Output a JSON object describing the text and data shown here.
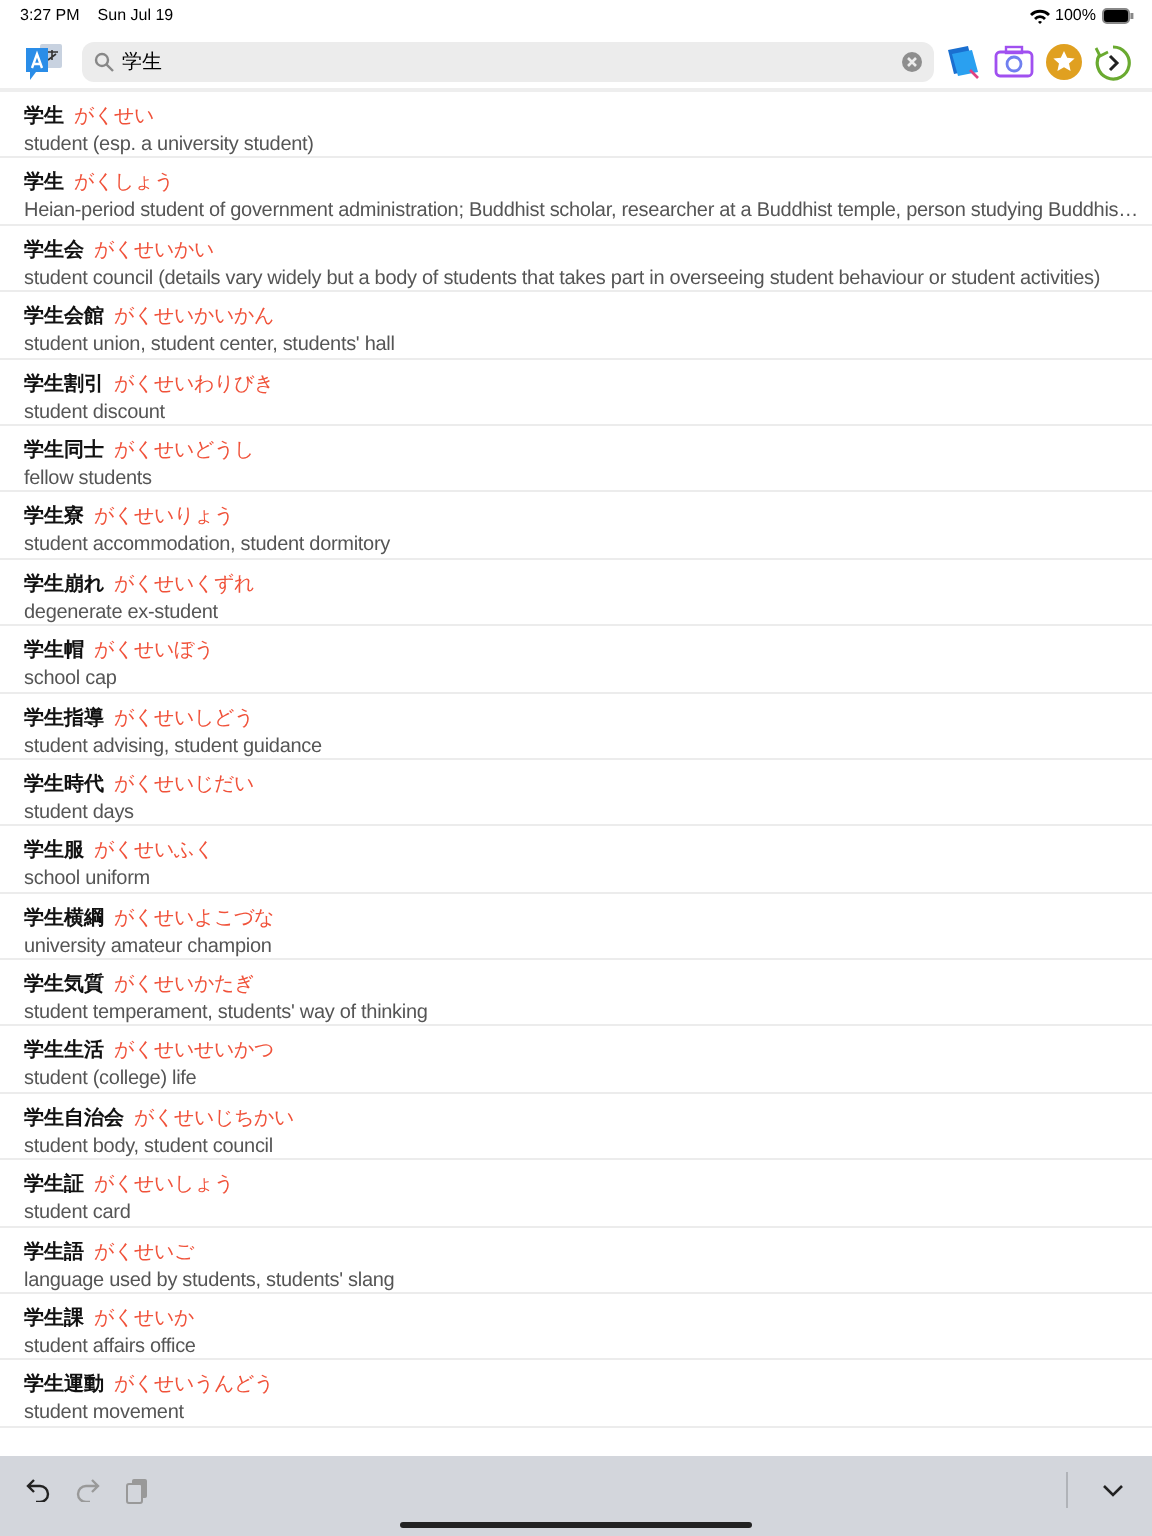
{
  "status_bar": {
    "time": "3:27 PM",
    "date": "Sun Jul 19",
    "battery": "100%"
  },
  "search": {
    "value": "学生"
  },
  "entries": [
    {
      "headword": "学生",
      "reading": "がくせい",
      "gloss": "student (esp. a university student)"
    },
    {
      "headword": "学生",
      "reading": "がくしょう",
      "gloss": "Heian-period student of government administration; Buddhist scholar, researcher at a Buddhist temple, person studying Buddhis…"
    },
    {
      "headword": "学生会",
      "reading": "がくせいかい",
      "gloss": "student council (details vary widely but a body of students that takes part in overseeing student behaviour or student activities)"
    },
    {
      "headword": "学生会館",
      "reading": "がくせいかいかん",
      "gloss": "student union, student center, students' hall"
    },
    {
      "headword": "学生割引",
      "reading": "がくせいわりびき",
      "gloss": "student discount"
    },
    {
      "headword": "学生同士",
      "reading": "がくせいどうし",
      "gloss": "fellow students"
    },
    {
      "headword": "学生寮",
      "reading": "がくせいりょう",
      "gloss": "student accommodation, student dormitory"
    },
    {
      "headword": "学生崩れ",
      "reading": "がくせいくずれ",
      "gloss": "degenerate ex-student"
    },
    {
      "headword": "学生帽",
      "reading": "がくせいぼう",
      "gloss": "school cap"
    },
    {
      "headword": "学生指導",
      "reading": "がくせいしどう",
      "gloss": "student advising, student guidance"
    },
    {
      "headword": "学生時代",
      "reading": "がくせいじだい",
      "gloss": "student days"
    },
    {
      "headword": "学生服",
      "reading": "がくせいふく",
      "gloss": "school uniform"
    },
    {
      "headword": "学生横綱",
      "reading": "がくせいよこづな",
      "gloss": "university amateur champion"
    },
    {
      "headword": "学生気質",
      "reading": "がくせいかたぎ",
      "gloss": "student temperament, students' way of thinking"
    },
    {
      "headword": "学生生活",
      "reading": "がくせいせいかつ",
      "gloss": "student (college) life"
    },
    {
      "headword": "学生自治会",
      "reading": "がくせいじちかい",
      "gloss": "student body, student council"
    },
    {
      "headword": "学生証",
      "reading": "がくせいしょう",
      "gloss": "student card"
    },
    {
      "headword": "学生語",
      "reading": "がくせいご",
      "gloss": "language used by students, students' slang"
    },
    {
      "headword": "学生課",
      "reading": "がくせいか",
      "gloss": "student affairs office"
    },
    {
      "headword": "学生運動",
      "reading": "がくせいうんどう",
      "gloss": "student movement"
    }
  ]
}
